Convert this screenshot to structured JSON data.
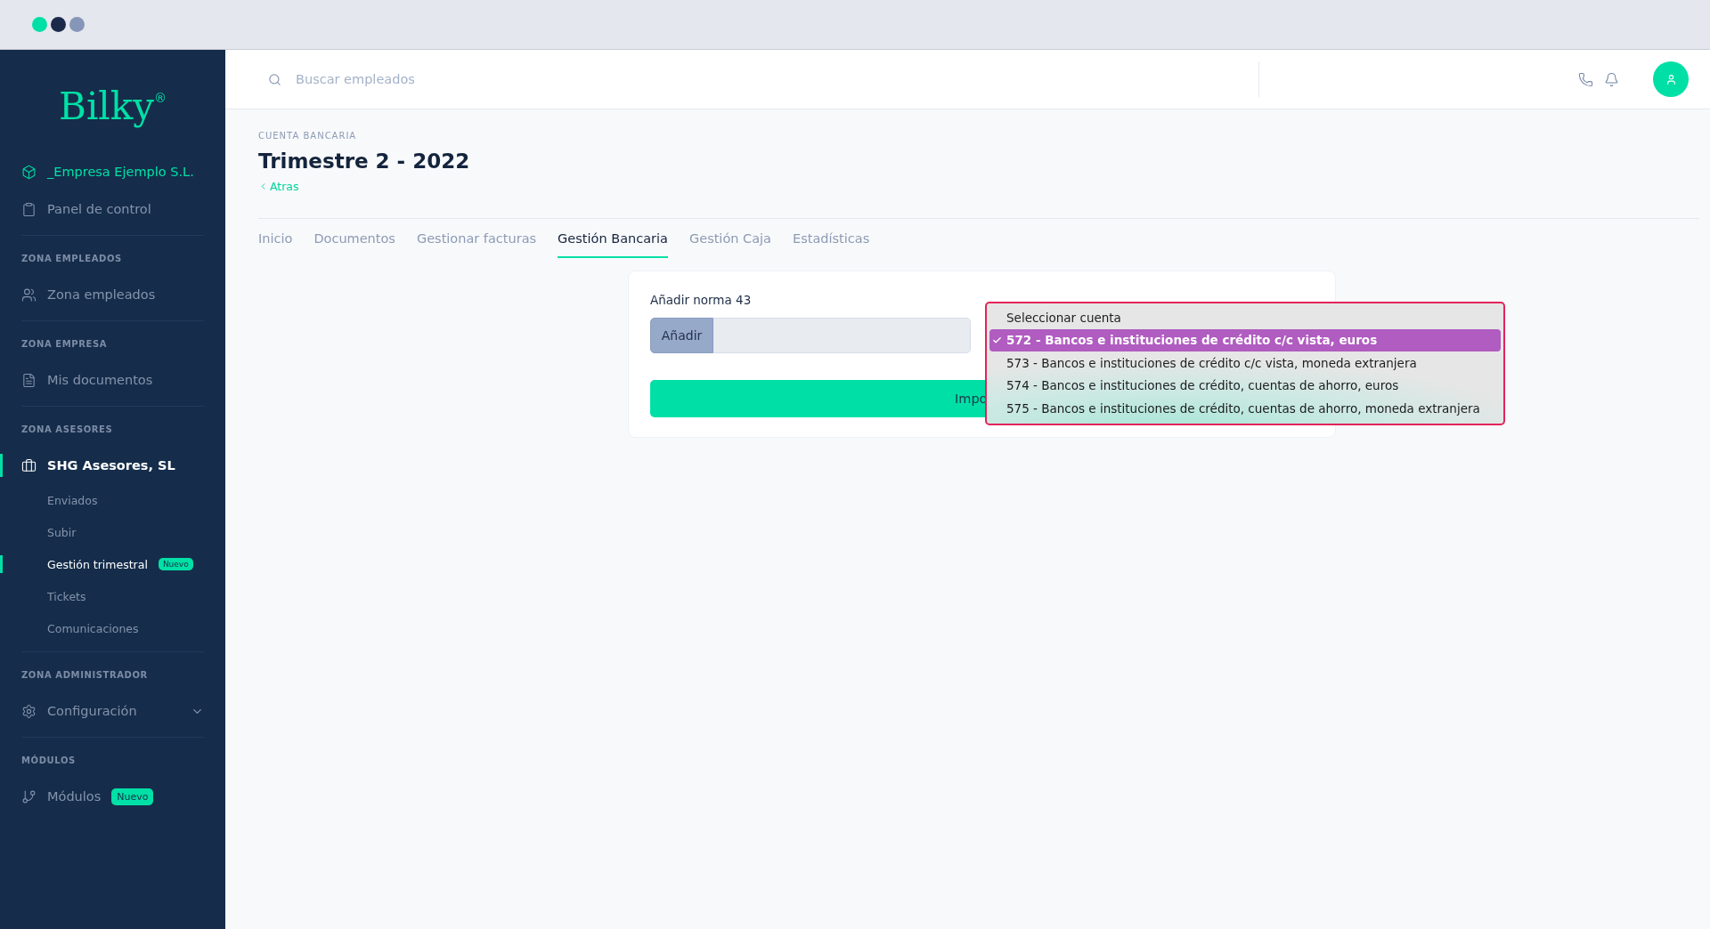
{
  "window": {
    "controls": [
      {
        "color": "#00e0a6"
      },
      {
        "color": "#1b2a4a"
      },
      {
        "color": "#8696b8"
      }
    ]
  },
  "sidebar": {
    "logo": "Bilky",
    "logo_mark": "®",
    "sections": [
      {
        "items": [
          {
            "kind": "company",
            "label": "_Empresa Ejemplo S.L."
          },
          {
            "kind": "main",
            "label": "Panel de control",
            "selected": false
          }
        ]
      },
      {
        "label": "ZONA EMPLEADOS",
        "items": [
          {
            "kind": "main",
            "label": "Zona empleados",
            "selected": false
          }
        ]
      },
      {
        "label": "ZONA EMPRESA",
        "items": [
          {
            "kind": "main",
            "label": "Mis documentos",
            "selected": false
          }
        ]
      },
      {
        "label": "ZONA ASESORES",
        "items": [
          {
            "kind": "main",
            "label": "SHG Asesores, SL",
            "selected": true
          },
          {
            "kind": "sub",
            "label": "Enviados",
            "selected": false
          },
          {
            "kind": "sub",
            "label": "Subir",
            "selected": false
          },
          {
            "kind": "sub",
            "label": "Gestión trimestral",
            "selected": true,
            "badge": "Nuevo"
          },
          {
            "kind": "sub",
            "label": "Tickets",
            "selected": false
          },
          {
            "kind": "sub",
            "label": "Comunicaciones",
            "selected": false
          }
        ]
      },
      {
        "label": "ZONA ADMINISTRADOR",
        "items": [
          {
            "kind": "main",
            "label": "Configuración",
            "selected": false,
            "expanded": false
          }
        ]
      },
      {
        "label": "MÓDULOS",
        "items": [
          {
            "kind": "main",
            "label": "Módulos",
            "selected": false,
            "badge": "Nuevo"
          }
        ]
      }
    ]
  },
  "header": {
    "search": {
      "placeholder": "Buscar empleados"
    }
  },
  "page": {
    "eyebrow": "CUENTA BANCARIA",
    "title": "Trimestre 2 - 2022",
    "back_link": "Atras"
  },
  "tabs": [
    {
      "label": "Inicio",
      "selected": false
    },
    {
      "label": "Documentos",
      "selected": false
    },
    {
      "label": "Gestionar facturas",
      "selected": false
    },
    {
      "label": "Gestión Bancaria",
      "selected": true
    },
    {
      "label": "Gestión Caja",
      "selected": false
    },
    {
      "label": "Estadísticas",
      "selected": false
    }
  ],
  "card": {
    "upload_label": "Añadir norma 43",
    "upload_button": "Añadir",
    "submit_button": "Impo",
    "dropdown": {
      "options": [
        {
          "label": "Seleccionar cuenta",
          "selected": false
        },
        {
          "label": "572 - Bancos e instituciones de crédito c/c vista, euros",
          "selected": true
        },
        {
          "label": "573 - Bancos e instituciones de crédito c/c vista, moneda extranjera",
          "selected": false
        },
        {
          "label": "574 - Bancos e instituciones de crédito, cuentas de ahorro, euros",
          "selected": false
        },
        {
          "label": "575 - Bancos e instituciones de crédito, cuentas de ahorro, moneda extranjera",
          "selected": false
        }
      ]
    }
  }
}
